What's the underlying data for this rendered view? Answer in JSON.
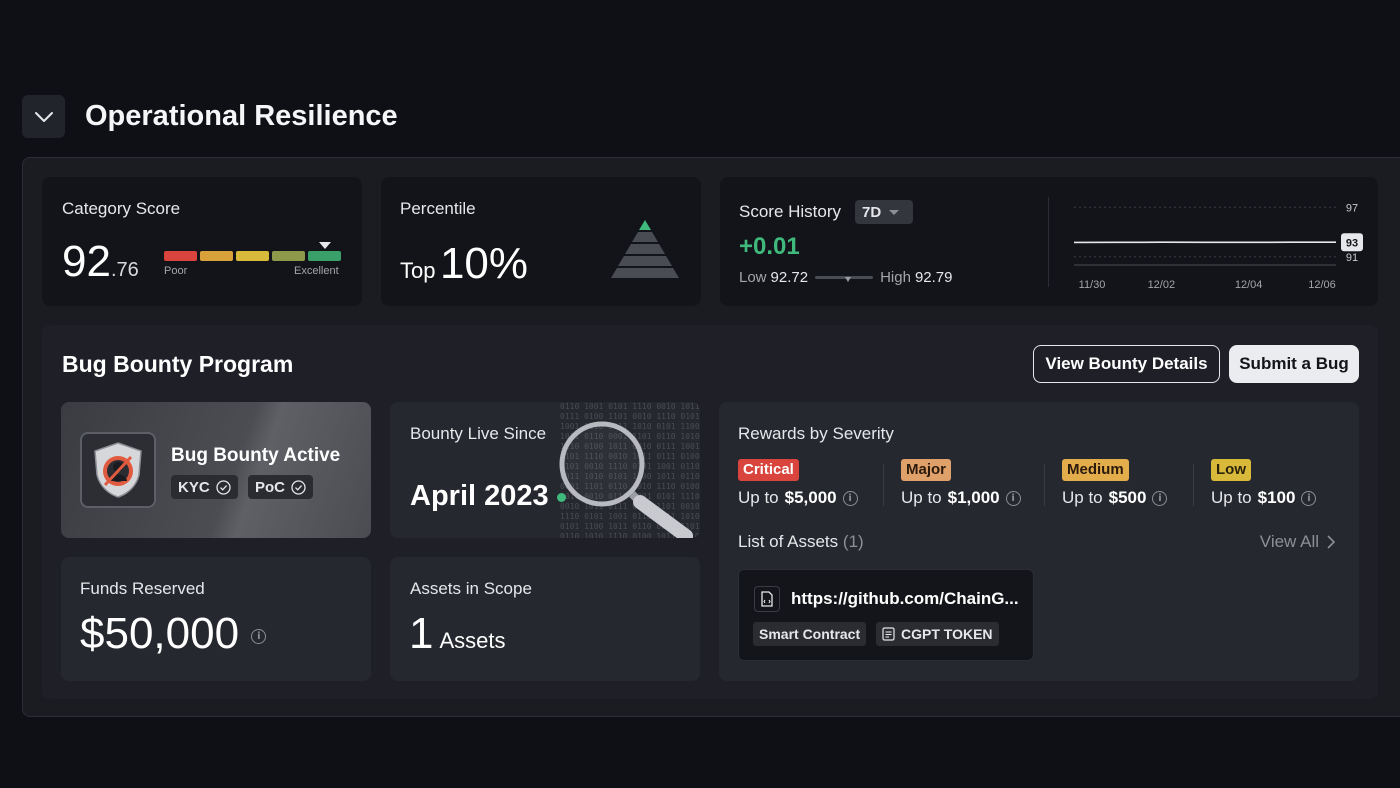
{
  "section": {
    "title": "Operational Resilience"
  },
  "category_score": {
    "label": "Category Score",
    "integer": "92",
    "decimal": ".76",
    "bar_low_label": "Poor",
    "bar_high_label": "Excellent",
    "bar_colors": [
      "#d9443c",
      "#d9a13a",
      "#d9b93a",
      "#8e9a4a",
      "#3aa06a"
    ],
    "level": 0.9276
  },
  "percentile": {
    "label": "Percentile",
    "prefix": "Top",
    "value": "10%"
  },
  "score_history": {
    "label": "Score History",
    "range": "7D",
    "delta": "+0.01",
    "low_label": "Low",
    "low_value": "92.72",
    "high_label": "High",
    "high_value": "92.79",
    "chart_data": {
      "type": "line",
      "x": [
        "11/30",
        "12/01",
        "12/02",
        "12/03",
        "12/04",
        "12/05",
        "12/06"
      ],
      "x_ticks": [
        "11/30",
        "12/02",
        "12/04",
        "12/06"
      ],
      "series": [
        {
          "values": [
            92.74,
            92.75,
            92.76,
            92.75,
            92.75,
            92.76,
            92.76
          ]
        }
      ],
      "ylim": [
        90,
        98
      ],
      "y_ticks": [
        "97",
        "91"
      ],
      "current_label": "93",
      "grid": true
    }
  },
  "bug_bounty": {
    "title": "Bug Bounty Program",
    "view_details_label": "View Bounty Details",
    "submit_label": "Submit a Bug",
    "active": {
      "title": "Bug Bounty Active",
      "chips": [
        "KYC",
        "PoC"
      ]
    },
    "live_since": {
      "label": "Bounty Live Since",
      "date": "April 2023"
    },
    "funds": {
      "label": "Funds Reserved",
      "value": "$50,000"
    },
    "assets_scope": {
      "label": "Assets in Scope",
      "count": "1",
      "unit": "Assets"
    },
    "rewards": {
      "label": "Rewards by Severity",
      "items": [
        {
          "level": "Critical",
          "prefix": "Up to",
          "amount": "$5,000",
          "bg": "#d9443c",
          "fg": "#ffffff"
        },
        {
          "level": "Major",
          "prefix": "Up to",
          "amount": "$1,000",
          "bg": "#e0a06a",
          "fg": "#2a1a0c"
        },
        {
          "level": "Medium",
          "prefix": "Up to",
          "amount": "$500",
          "bg": "#e4ad4c",
          "fg": "#2a1a0c"
        },
        {
          "level": "Low",
          "prefix": "Up to",
          "amount": "$100",
          "bg": "#d9b93a",
          "fg": "#2a220c"
        }
      ],
      "assets_list_label": "List of Assets",
      "assets_list_count": "(1)",
      "view_all_label": "View All",
      "asset": {
        "url": "https://github.com/ChainG...",
        "tags": [
          "Smart Contract",
          "CGPT TOKEN"
        ]
      }
    }
  }
}
